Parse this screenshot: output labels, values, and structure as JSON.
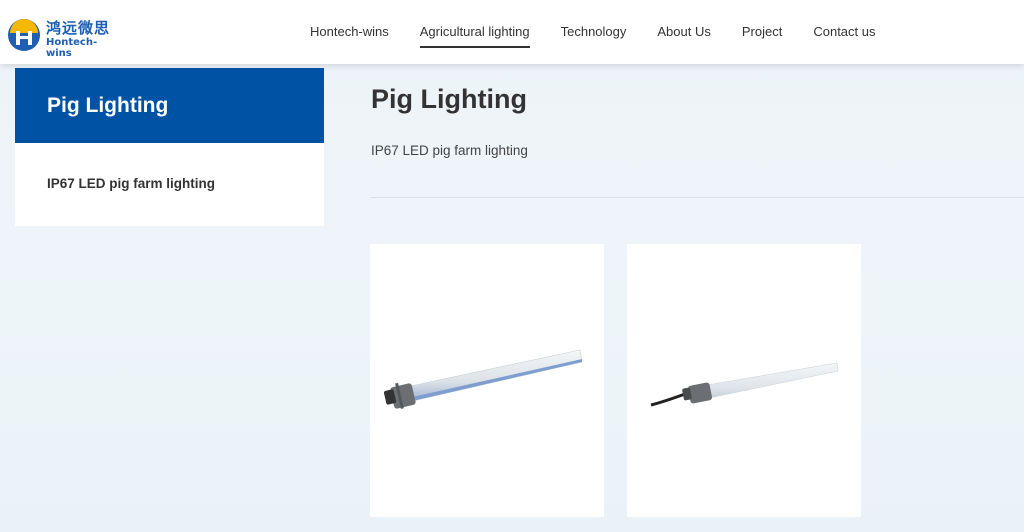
{
  "header": {
    "logo": {
      "cn_text": "鸿远微思",
      "en_text": "Hontech-wins"
    },
    "nav": [
      {
        "label": "Hontech-wins",
        "active": false
      },
      {
        "label": "Agricultural lighting",
        "active": true
      },
      {
        "label": "Technology",
        "active": false
      },
      {
        "label": "About Us",
        "active": false
      },
      {
        "label": "Project",
        "active": false
      },
      {
        "label": "Contact us",
        "active": false
      }
    ]
  },
  "sidebar": {
    "title": "Pig Lighting",
    "items": [
      {
        "label": "IP67 LED pig farm lighting"
      }
    ]
  },
  "main": {
    "title": "Pig Lighting",
    "subtitle": "IP67 LED pig farm lighting",
    "products": [
      {
        "image": "led-tube-light-image"
      },
      {
        "image": "led-tube-light-with-cable-image"
      }
    ]
  },
  "colors": {
    "brand_blue": "#0052a5",
    "logo_blue": "#1e5fb3",
    "logo_yellow": "#f5b800"
  }
}
